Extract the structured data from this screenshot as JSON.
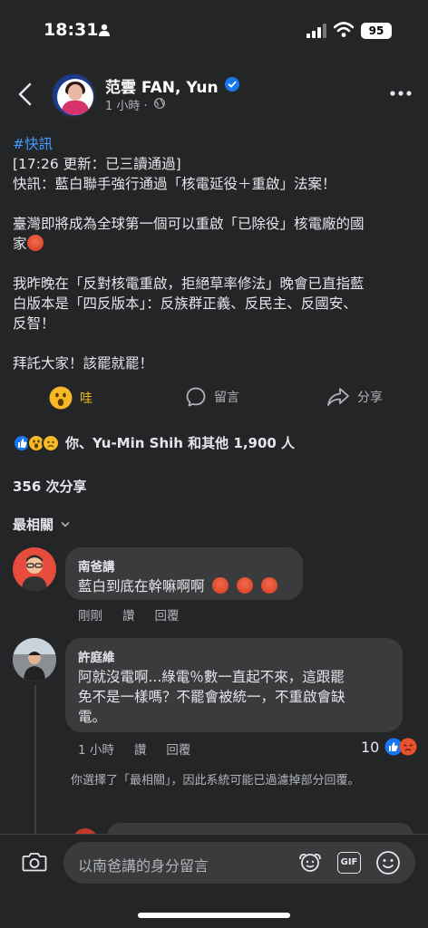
{
  "status_bar": {
    "time": "18:31",
    "battery": "95"
  },
  "header": {
    "author": "范雲  FAN, Yun",
    "meta": "1 小時 · "
  },
  "post": {
    "hashtag": "#快訊",
    "lines": [
      "[17:26 更新：已三讀通過]",
      "快訊：藍白聯手強行通過「核電延役＋重啟」法案！",
      "",
      "臺灣即將成為全球第一個可以重啟「已除役」核電廠的國",
      "家",
      "",
      "我昨晚在「反對核電重啟，拒絕草率修法」晚會已直指藍",
      "白版本是「四反版本」：反族群正義、反民主、反國安、",
      "反智！",
      "",
      "拜託大家！該罷就罷！"
    ]
  },
  "actions": {
    "wow": "哇",
    "comment": "留言",
    "share": "分享"
  },
  "reactions": {
    "summary": "你、Yu-Min Shih 和其他 1,900 人"
  },
  "shares": "356 次分享",
  "sort": {
    "label": "最相關"
  },
  "comments": [
    {
      "name": "南爸講",
      "text": "藍白到底在幹嘛啊啊",
      "time": "剛剛",
      "like": "讚",
      "reply": "回覆"
    },
    {
      "name": "許庭維",
      "text_lines": [
        "阿就沒電啊...綠電％數一直起不來，這跟罷",
        "免不是一樣嗎？不罷會被統一，不重啟會缺",
        "電。"
      ],
      "time": "1 小時",
      "like": "讚",
      "reply": "回覆",
      "reaction_count": "10"
    }
  ],
  "filter_note": "你選擇了「最相關」，因此系統可能已過濾掉部分回覆。",
  "composer": {
    "placeholder": "以南爸講的身分留言",
    "gif": "GIF"
  },
  "colors": {
    "background": "#242526",
    "bubble": "#3a3b3c",
    "link": "#4599ff",
    "like_blue": "#1877f2",
    "wow_yellow": "#f7b928"
  }
}
